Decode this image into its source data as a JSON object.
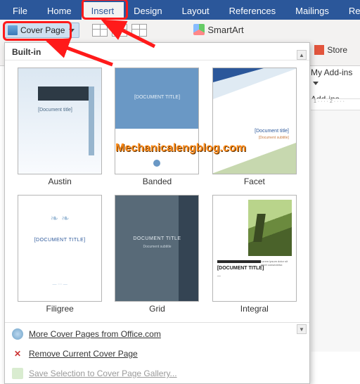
{
  "ribbon": {
    "tabs": [
      "File",
      "Home",
      "Insert",
      "Design",
      "Layout",
      "References",
      "Mailings",
      "Review"
    ],
    "active_index": 2,
    "cover_page_label": "Cover Page",
    "smartart_label": "SmartArt",
    "store_label": "Store",
    "my_addins_label": "My Add-ins",
    "addins_label": "Add-ins"
  },
  "dropdown": {
    "section": "Built-in",
    "items": [
      {
        "name": "Austin",
        "title": "[Document title]",
        "sub": ""
      },
      {
        "name": "Banded",
        "title": "[DOCUMENT TITLE]",
        "sub": ""
      },
      {
        "name": "Facet",
        "title": "[Document title]",
        "sub": "[Document subtitle]"
      },
      {
        "name": "Filigree",
        "title": "[DOCUMENT TITLE]",
        "sub": ""
      },
      {
        "name": "Grid",
        "title": "DOCUMENT TITLE",
        "sub": "Document subtitle"
      },
      {
        "name": "Integral",
        "title": "[DOCUMENT TITLE]",
        "sub": ""
      }
    ],
    "more_label": "More Cover Pages from Office.com",
    "remove_label": "Remove Current Cover Page",
    "save_sel_label": "Save Selection to Cover Page Gallery..."
  },
  "watermark": "Mechanicalengblog.com",
  "ruler_marks": "1 · · · · 2 · · · ·"
}
